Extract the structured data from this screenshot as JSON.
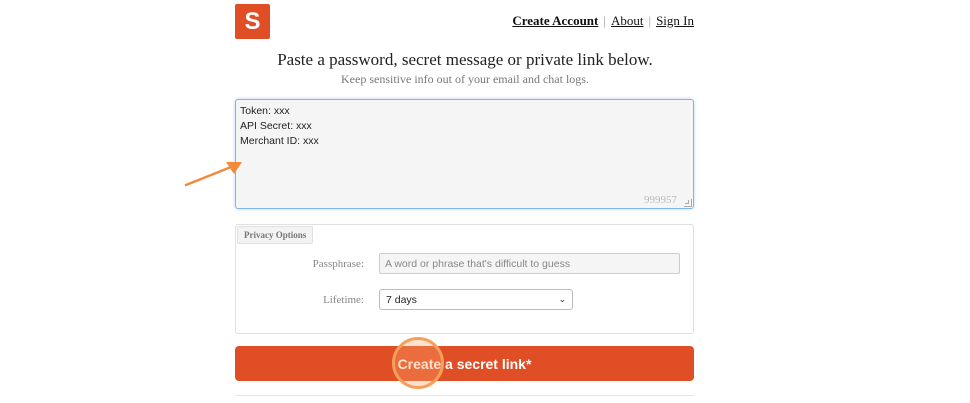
{
  "brand": {
    "logo_letter": "S",
    "accent": "#e04e25"
  },
  "nav": {
    "create_account": "Create Account",
    "about": "About",
    "sign_in": "Sign In",
    "separator": "|"
  },
  "hero": {
    "headline": "Paste a password, secret message or private link below.",
    "subline": "Keep sensitive info out of your email and chat logs."
  },
  "secret": {
    "value": "Token: xxx\nAPI Secret: xxx\nMerchant ID: xxx",
    "char_count": "999957"
  },
  "privacy": {
    "tab_label": "Privacy Options",
    "passphrase_label": "Passphrase:",
    "passphrase_placeholder": "A word or phrase that's difficult to guess",
    "lifetime_label": "Lifetime:",
    "lifetime_value": "7 days"
  },
  "actions": {
    "create_label": "Create a secret link*"
  },
  "annotation": {
    "arrow_color": "#f28a3c",
    "ring_color": "#f5a05a"
  }
}
